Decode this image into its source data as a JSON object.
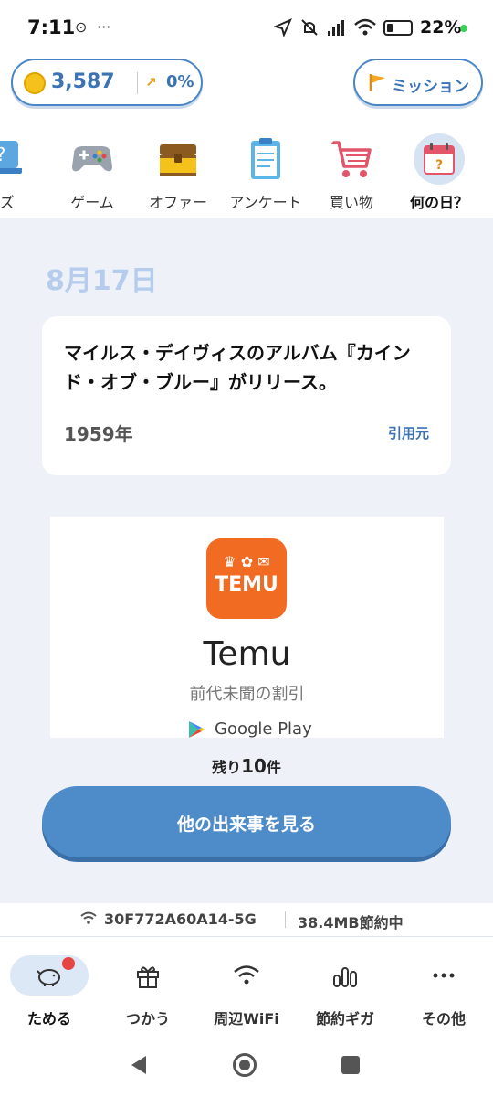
{
  "status": {
    "time": "7:11",
    "battery": "22%"
  },
  "header": {
    "points": "3,587",
    "rate": "0%",
    "mission_label": "ミッション"
  },
  "categories": [
    {
      "label": "イズ",
      "icon": "quiz-icon",
      "selected": false
    },
    {
      "label": "ゲーム",
      "icon": "gamepad-icon",
      "selected": false
    },
    {
      "label": "オファー",
      "icon": "treasure-chest-icon",
      "selected": false
    },
    {
      "label": "アンケート",
      "icon": "clipboard-icon",
      "selected": false
    },
    {
      "label": "買い物",
      "icon": "shopping-cart-icon",
      "selected": false
    },
    {
      "label": "何の日？",
      "icon": "calendar-icon",
      "selected": true
    }
  ],
  "content": {
    "date": "8月17日",
    "event_text": "マイルス・デイヴィスのアルバム『カインド・オブ・ブルー』がリリース。",
    "year": "1959年",
    "source_label": "引用元",
    "remaining_prefix": "残り",
    "remaining_count": "10",
    "remaining_suffix": "件",
    "more_button": "他の出来事を見る"
  },
  "ad": {
    "logo_text": "TEMU",
    "app_name": "Temu",
    "tagline": "前代未聞の割引",
    "store": "Google Play"
  },
  "wifi": {
    "ssid": "30F772A60A14-5G",
    "saved": "38.4MB節約中"
  },
  "bottom_nav": [
    {
      "label": "ためる",
      "icon": "piggy-bank-icon",
      "selected": true
    },
    {
      "label": "つかう",
      "icon": "gift-icon",
      "selected": false
    },
    {
      "label": "周辺WiFi",
      "icon": "wifi-icon",
      "selected": false
    },
    {
      "label": "節約ギガ",
      "icon": "data-bars-icon",
      "selected": false
    },
    {
      "label": "その他",
      "icon": "more-dots-icon",
      "selected": false
    }
  ],
  "colors": {
    "accent": "#4e8bc9",
    "date": "#b6ccec",
    "background": "#eef1f7",
    "temu": "#f26b22"
  }
}
